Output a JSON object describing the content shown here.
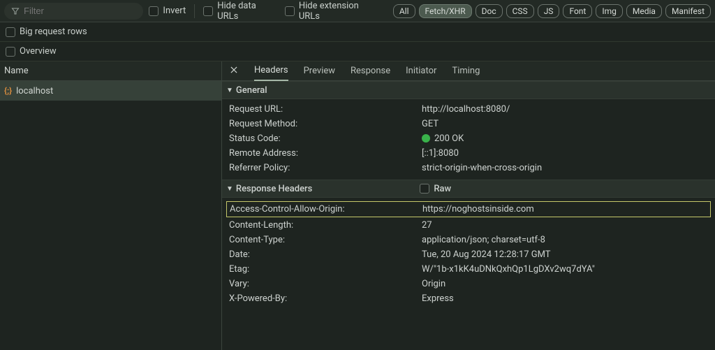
{
  "toolbar": {
    "filter_placeholder": "Filter",
    "invert_label": "Invert",
    "hide_data_urls_label": "Hide data URLs",
    "hide_ext_urls_label": "Hide extension URLs",
    "pills": [
      "All",
      "Fetch/XHR",
      "Doc",
      "CSS",
      "JS",
      "Font",
      "Img",
      "Media",
      "Manifest"
    ],
    "active_pill_index": 1
  },
  "subrows": {
    "big_request_rows_label": "Big request rows",
    "overview_label": "Overview"
  },
  "left": {
    "column_header": "Name",
    "requests": [
      {
        "icon": "{;}",
        "name": "localhost"
      }
    ]
  },
  "right": {
    "tabs": [
      "Headers",
      "Preview",
      "Response",
      "Initiator",
      "Timing"
    ],
    "active_tab_index": 0,
    "sections": {
      "general": {
        "title": "General",
        "rows": [
          {
            "key": "Request URL:",
            "value": "http://localhost:8080/"
          },
          {
            "key": "Request Method:",
            "value": "GET"
          },
          {
            "key": "Status Code:",
            "value": "200 OK",
            "status_dot": true
          },
          {
            "key": "Remote Address:",
            "value": "[::1]:8080"
          },
          {
            "key": "Referrer Policy:",
            "value": "strict-origin-when-cross-origin"
          }
        ]
      },
      "response_headers": {
        "title": "Response Headers",
        "raw_label": "Raw",
        "rows": [
          {
            "key": "Access-Control-Allow-Origin:",
            "value": "https://noghostsinside.com",
            "highlight": true
          },
          {
            "key": "Content-Length:",
            "value": "27"
          },
          {
            "key": "Content-Type:",
            "value": "application/json; charset=utf-8"
          },
          {
            "key": "Date:",
            "value": "Tue, 20 Aug 2024 12:28:17 GMT"
          },
          {
            "key": "Etag:",
            "value": "W/\"1b-x1kK4uDNkQxhQp1LgDXv2wq7dYA\""
          },
          {
            "key": "Vary:",
            "value": "Origin"
          },
          {
            "key": "X-Powered-By:",
            "value": "Express"
          }
        ]
      }
    }
  }
}
